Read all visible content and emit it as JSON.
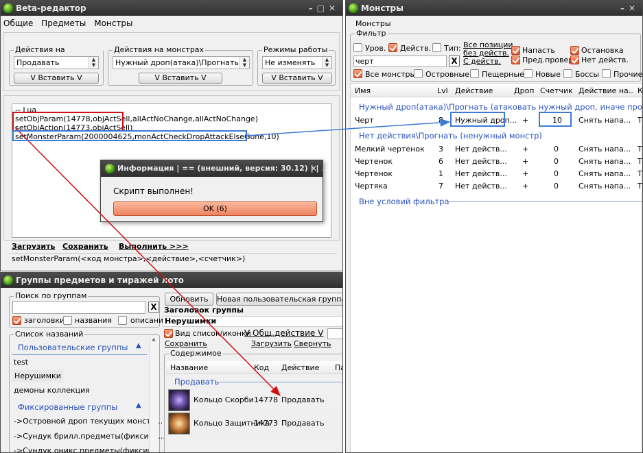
{
  "editor": {
    "title": "Beta-редактор",
    "menu": [
      "Общие",
      "Предметы",
      "Монстры"
    ],
    "groups": {
      "items_actions": {
        "title": "Действия на предметах",
        "combo": "Продавать",
        "button": "V Вставить V"
      },
      "monster_actions": {
        "title": "Действия на монстрах",
        "combo": "Нужный дроп(атака)\\Прогнать",
        "button": "V Вставить V"
      },
      "work_modes": {
        "title": "Режимы работы",
        "combo": "Не изменять",
        "button": "V Вставить V"
      }
    },
    "code_lines": [
      "-- Lua",
      "setObjParam(14778,objActSell,allActNoChange,allActNoChange)",
      "setObjAction(14773,objActSell)",
      "setMonsterParam(2000004625,monActCheckDropAttackElseGone,10)"
    ],
    "links": {
      "load": "Загрузить",
      "save": "Сохранить",
      "run": "Выполнить >>>"
    },
    "status": "setMonsterParam(<код монстра>,<действие>,<счетчик>)"
  },
  "dialog": {
    "title": "Информация | == (внешний, версия: 30.12) | | ...",
    "message": "Скрипт выполнен!",
    "ok": "OK (6)"
  },
  "groups_window": {
    "title": "Группы предметов и тиражей лото",
    "search": {
      "title": "Поиск по группам",
      "value": "",
      "x": "X",
      "checks": [
        {
          "label": "заголовки",
          "checked": true
        },
        {
          "label": "названия",
          "checked": false
        },
        {
          "label": "описания",
          "checked": false
        }
      ]
    },
    "names": {
      "title": "Список названий",
      "user_section": "Пользовательские группы",
      "user_items": [
        "test",
        "Нерушимки",
        "демоны коллекция"
      ],
      "fixed_section": "Фиксированные группы",
      "fixed_items": [
        "->Островной дроп текущих монстр...",
        "->Сундук брилл.предметы(фиксиро...",
        "->Сундук оникс.предметы(фиксиро..."
      ]
    },
    "buttons": {
      "refresh": "Обновить",
      "new_group": "Новая пользовательская группа"
    },
    "header_label": "Заголовок группы",
    "header_value": "Нерушимки",
    "view": {
      "label": "Вид список/иконки",
      "checked": true,
      "common_action": "V Общ.действие V"
    },
    "links": {
      "save": "Сохранить",
      "load": "Загрузить",
      "collapse": "Свернуть"
    },
    "contents": {
      "title": "Содержимое",
      "columns": [
        "Название",
        "Код",
        "Действие",
        "Па"
      ],
      "section": "Продавать",
      "rows": [
        {
          "name": "Кольцо Скорби",
          "code": "14778",
          "action": "Продавать"
        },
        {
          "name": "Кольцо Защитника",
          "code": "14773",
          "action": "Продавать"
        }
      ]
    }
  },
  "monsters": {
    "title": "Монстры",
    "tab": "Монстры",
    "filter": {
      "title": "Фильтр",
      "checks_top": [
        {
          "label": "Уров.",
          "checked": false
        },
        {
          "label": "Действ.",
          "checked": true
        },
        {
          "label": "Тип:",
          "checked": false
        }
      ],
      "all_positions": [
        "Все позиции",
        "без действ.",
        "С действ."
      ],
      "right_checks": [
        {
          "label": "Напасть",
          "checked": true
        },
        {
          "label": "Остановка",
          "checked": true
        },
        {
          "label": "Пред.провер",
          "checked": true
        },
        {
          "label": "Нет действ.",
          "checked": true
        }
      ],
      "search": "черт",
      "x": "X",
      "checks_bottom": [
        {
          "label": "Все монстры",
          "checked": true
        },
        {
          "label": "Островные",
          "checked": false
        },
        {
          "label": "Пещерные",
          "checked": false
        },
        {
          "label": "Новые",
          "checked": false
        },
        {
          "label": "Боссы",
          "checked": false
        },
        {
          "label": "Прочие",
          "checked": false
        }
      ]
    },
    "columns": [
      "Имя",
      "Lvl",
      "Действие",
      "Дроп",
      "Счетчик",
      "Действие на...",
      "К"
    ],
    "section1": "Нужный дроп(атака)\\Прогнать (атаковать нужный дроп, иначе прогнать м",
    "rows1": [
      {
        "name": "Черт",
        "lvl": "8",
        "action": "Нужный дроп...",
        "drop": "+",
        "counter": "10",
        "act2": "Снять напа...",
        "k": "T"
      }
    ],
    "section2": "Нет действия\\Прогнать (ненужный монстр)",
    "rows2": [
      {
        "name": "Мелкий чертенок",
        "lvl": "3",
        "action": "Нет действ...",
        "drop": "+",
        "counter": "0",
        "act2": "Снять напа...",
        "k": "T"
      },
      {
        "name": "Чертенок",
        "lvl": "6",
        "action": "Нет действ...",
        "drop": "+",
        "counter": "0",
        "act2": "Снять напа...",
        "k": "T"
      },
      {
        "name": "Чертенок",
        "lvl": "1",
        "action": "Нет действ...",
        "drop": "+",
        "counter": "0",
        "act2": "Снять напа...",
        "k": "T"
      },
      {
        "name": "Чертяка",
        "lvl": "7",
        "action": "Нет действ...",
        "drop": "+",
        "counter": "0",
        "act2": "Снять напа...",
        "k": "T"
      }
    ],
    "section3": "Вне условий фильтра"
  },
  "colors": {
    "titlebar": "#3a3a3a",
    "accent_orange": "#e0582c",
    "section_blue": "#2a52be",
    "annot_red": "#d01010",
    "annot_blue": "#3c7ad6"
  }
}
